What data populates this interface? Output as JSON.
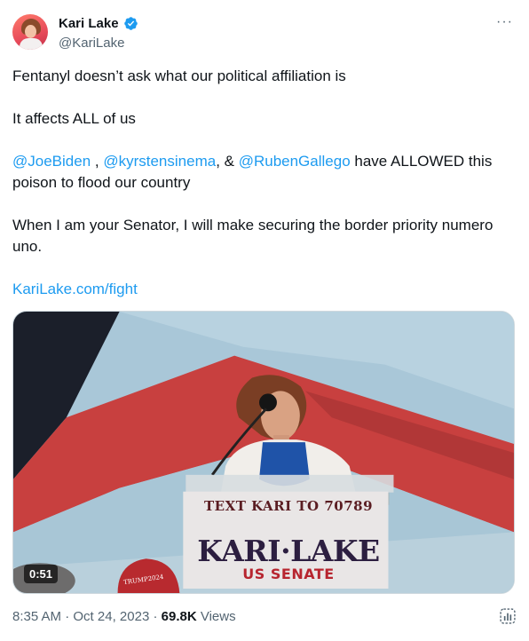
{
  "author": {
    "display_name": "Kari Lake",
    "handle": "@KariLake",
    "verified": true,
    "avatar_icon": "profile-photo"
  },
  "more_icon": "more-horizontal-icon",
  "tweet": {
    "line1": "Fentanyl doesn’t ask what our political affiliation is",
    "line2": "It affects ALL of us",
    "mention1": "@JoeBiden",
    "sep1": " , ",
    "mention2": "@kyrstensinema",
    "sep2": ", & ",
    "mention3": "@RubenGallego",
    "line3_tail": " have ALLOWED this poison to flood our country",
    "line4": "When I am your Senator, I will make securing the border priority numero uno.",
    "link": "KariLake.com/fight"
  },
  "media": {
    "duration": "0:51",
    "sign_line1": "TEXT KARI TO 70789",
    "sign_line2": "KARI·LAKE",
    "sign_line3": "US SENATE",
    "hat_text": "TRUMP2024"
  },
  "meta": {
    "time": "8:35 AM",
    "dot1": " · ",
    "date": "Oct 24, 2023",
    "dot2": " · ",
    "views_count": "69.8K",
    "views_label": " Views"
  },
  "colors": {
    "link": "#1d9bf0",
    "verified": "#1d9bf0",
    "secondary_text": "#536471"
  }
}
